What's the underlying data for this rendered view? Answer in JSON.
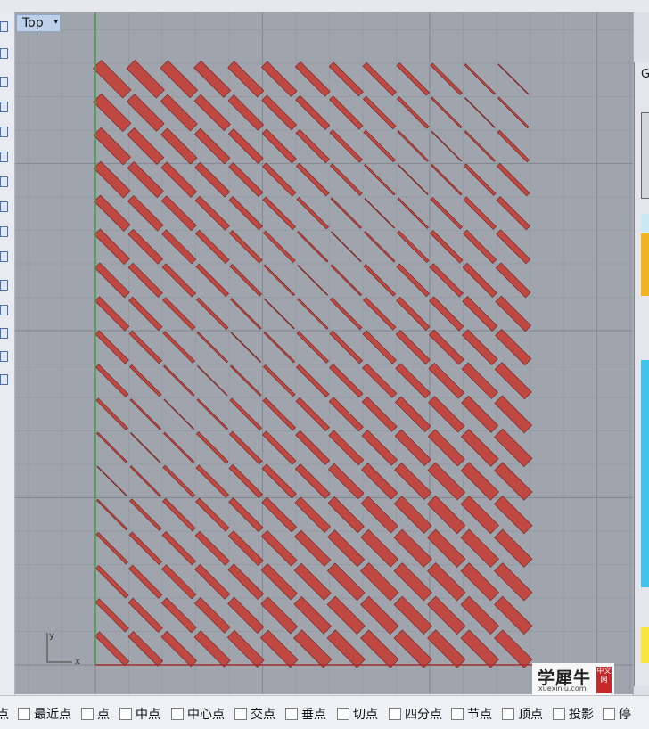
{
  "viewport": {
    "name": "Top",
    "axis_x": "x",
    "axis_y": "y",
    "menu_glyph": "▾",
    "colors": {
      "background": "#a0a5ad",
      "grid_minor": "#969ba3",
      "grid_major": "#878b93",
      "y_axis": "#3fa045",
      "x_axis": "#a33030",
      "shape_fill": "#bf4842",
      "shape_stroke": "#6e1f1b"
    }
  },
  "right_panel": {
    "title": "G"
  },
  "watermark": {
    "brand": "学犀牛",
    "url": "xuexiniu.com",
    "badge": "中文网"
  },
  "snaps": [
    {
      "label": "点",
      "checked": false
    },
    {
      "label": "最近点",
      "checked": false
    },
    {
      "label": "点",
      "checked": false
    },
    {
      "label": "中点",
      "checked": false
    },
    {
      "label": "中心点",
      "checked": false
    },
    {
      "label": "交点",
      "checked": false
    },
    {
      "label": "垂点",
      "checked": false
    },
    {
      "label": "切点",
      "checked": false
    },
    {
      "label": "四分点",
      "checked": false
    },
    {
      "label": "节点",
      "checked": false
    },
    {
      "label": "顶点",
      "checked": false
    },
    {
      "label": "投影",
      "checked": false
    },
    {
      "label": "停",
      "checked": false
    }
  ]
}
